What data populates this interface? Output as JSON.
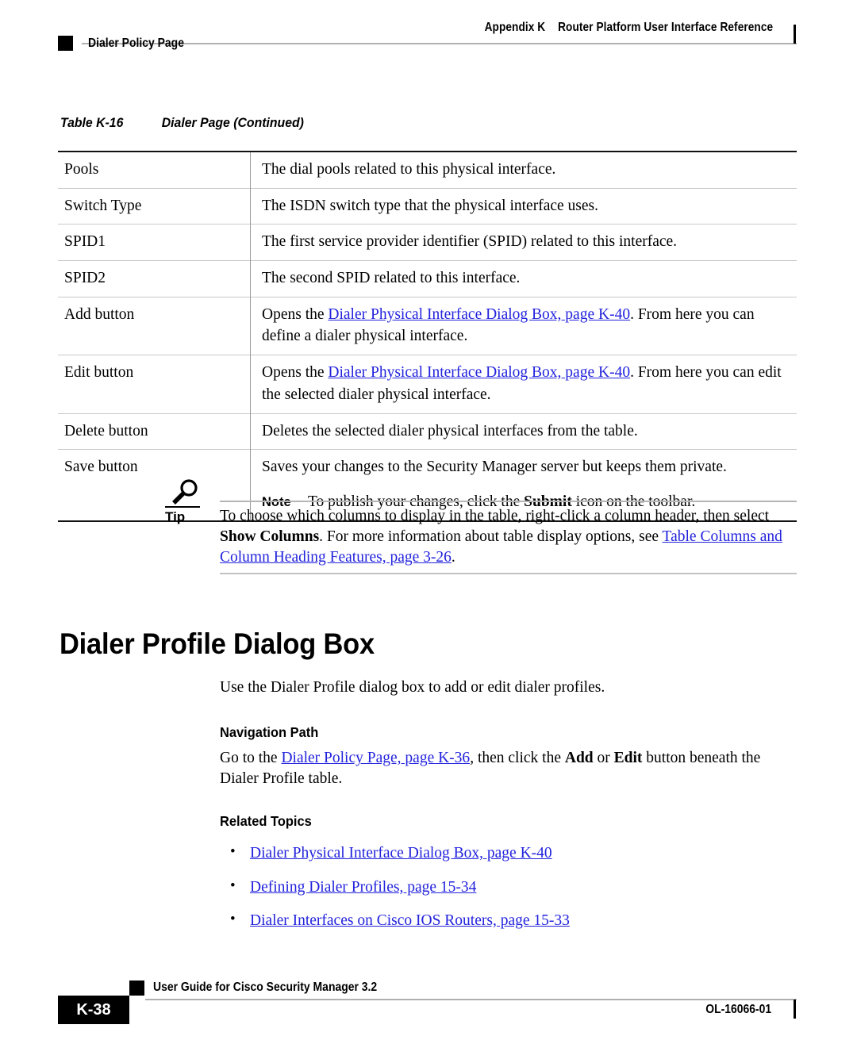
{
  "header": {
    "appendix": "Appendix K",
    "title": "Router Platform User Interface Reference",
    "subtitle": "Dialer Policy Page"
  },
  "table": {
    "caption_number": "Table K-16",
    "caption_title": "Dialer Page (Continued)",
    "rows": [
      {
        "term": "Pools",
        "desc": "The dial pools related to this physical interface."
      },
      {
        "term": "Switch Type",
        "desc": "The ISDN switch type that the physical interface uses."
      },
      {
        "term": "SPID1",
        "desc": "The first service provider identifier (SPID) related to this interface."
      },
      {
        "term": "SPID2",
        "desc": "The second SPID related to this interface."
      },
      {
        "term": "Add button",
        "desc_prefix": "Opens the ",
        "desc_link": "Dialer Physical Interface Dialog Box, page K-40",
        "desc_suffix": ". From here you can define a dialer physical interface."
      },
      {
        "term": "Edit button",
        "desc_prefix": "Opens the ",
        "desc_link": "Dialer Physical Interface Dialog Box, page K-40",
        "desc_suffix": ". From here you can edit the selected dialer physical interface."
      },
      {
        "term": "Delete button",
        "desc": "Deletes the selected dialer physical interfaces from the table."
      },
      {
        "term": "Save button",
        "desc": "Saves your changes to the Security Manager server but keeps them private.",
        "note_label": "Note",
        "note_prefix": "To publish your changes, click the ",
        "note_bold": "Submit",
        "note_suffix": " icon on the toolbar."
      }
    ]
  },
  "tip": {
    "icon": "magnifier-icon",
    "label": "Tip",
    "text_part1": "To choose which columns to display in the table, right-click a column header, then select ",
    "text_bold": "Show Columns",
    "text_part2": ". For more information about table display options, see ",
    "link": "Table Columns and Column Heading Features, page 3-26",
    "text_part3": "."
  },
  "section": {
    "heading": "Dialer Profile Dialog Box",
    "intro": "Use the Dialer Profile dialog box to add or edit dialer profiles.",
    "navigation_heading": "Navigation Path",
    "navigation_prefix": "Go to the ",
    "navigation_link": "Dialer Policy Page, page K-36",
    "navigation_mid": ", then click the ",
    "navigation_bold1": "Add",
    "navigation_or": " or ",
    "navigation_bold2": "Edit",
    "navigation_suffix": " button beneath the Dialer Profile table.",
    "related_heading": "Related Topics",
    "related_topics": [
      "Dialer Physical Interface Dialog Box, page K-40",
      "Defining Dialer Profiles, page 15-34",
      "Dialer Interfaces on Cisco IOS Routers, page 15-33"
    ]
  },
  "footer": {
    "guide": "User Guide for Cisco Security Manager 3.2",
    "page_number": "K-38",
    "doc_number": "OL-16066-01"
  },
  "colors": {
    "link": "#2222dd",
    "rule": "#b0b0b0",
    "table_border": "#111111"
  }
}
